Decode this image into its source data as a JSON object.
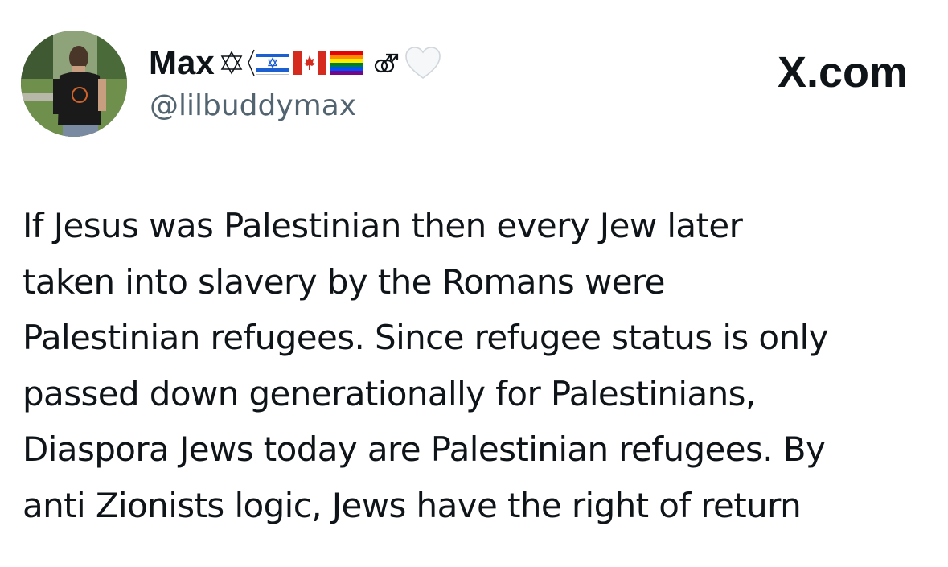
{
  "author": {
    "display_name": "Max",
    "handle": "@lilbuddymax",
    "avatar_icon": "profile-photo",
    "name_emojis": [
      "star-of-david-icon",
      "israel-flag-icon",
      "canada-flag-icon",
      "rainbow-flag-icon",
      "double-male-symbol-icon",
      "white-heart-icon"
    ]
  },
  "site": {
    "label": "X.com"
  },
  "tweet": {
    "lines": [
      "If Jesus was Palestinian then every Jew later",
      "taken into slavery by the Romans were",
      "Palestinian refugees. Since refugee status is only",
      "passed down generationally for Palestinians,",
      "Diaspora Jews today are Palestinian refugees. By",
      "anti Zionists logic, Jews have the right of return"
    ]
  },
  "colors": {
    "text": "#0f1419",
    "secondary": "#536471",
    "background": "#ffffff"
  }
}
